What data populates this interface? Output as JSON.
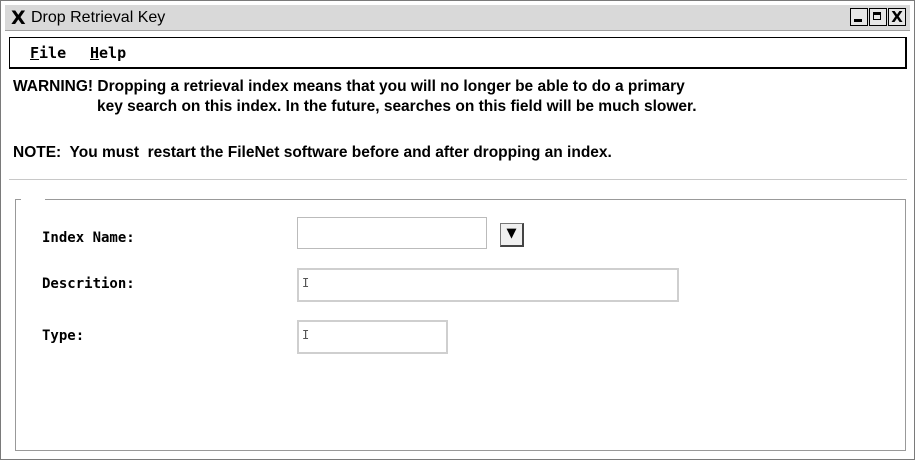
{
  "window": {
    "title": "Drop Retrieval Key",
    "icon": "x-window-icon",
    "controls": {
      "minimize": "_",
      "maximize": "□",
      "close": "X"
    }
  },
  "menu": {
    "file": {
      "mnemonic": "F",
      "rest": "ile"
    },
    "help": {
      "mnemonic": "H",
      "rest": "elp"
    }
  },
  "messages": {
    "warning_line1": "WARNING! Dropping a retrieval index means that you will no longer be able to do a primary",
    "warning_line2": "key search on this index. In the future, searches on this field will be much slower.",
    "note": "NOTE:  You must  restart the FileNet software before and after dropping an index."
  },
  "form": {
    "index_name_label": "Index Name:",
    "index_name_value": "",
    "dropdown_arrow": "▼",
    "description_label": "Descrition:",
    "description_value": "",
    "type_label": "Type:",
    "type_value": ""
  },
  "colors": {
    "titlebar": "#d9d9d9",
    "background": "#ffffff",
    "text": "#000000"
  }
}
